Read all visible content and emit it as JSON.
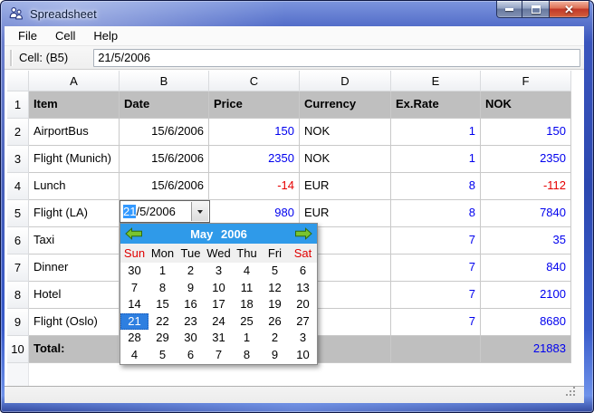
{
  "window": {
    "title": "Spreadsheet"
  },
  "titlebar_icons": {
    "close_glyph": "✕"
  },
  "menu": {
    "items": [
      "File",
      "Cell",
      "Help"
    ]
  },
  "toolbar": {
    "cell_label": "Cell: (B5)",
    "cell_value": "21/5/2006"
  },
  "spreadsheet": {
    "columns": [
      "A",
      "B",
      "C",
      "D",
      "E",
      "F"
    ],
    "rows": [
      {
        "num": "1",
        "bg": "gray",
        "cells": [
          {
            "t": "Item",
            "b": 1
          },
          {
            "t": "Date",
            "b": 1
          },
          {
            "t": "Price",
            "b": 1
          },
          {
            "t": "Currency",
            "b": 1
          },
          {
            "t": "Ex.Rate",
            "b": 1
          },
          {
            "t": "NOK",
            "b": 1
          }
        ]
      },
      {
        "num": "2",
        "cells": [
          {
            "t": "AirportBus"
          },
          {
            "t": "15/6/2006",
            "a": "r"
          },
          {
            "t": "150",
            "a": "r",
            "c": "blue"
          },
          {
            "t": "NOK"
          },
          {
            "t": "1",
            "a": "r",
            "c": "blue"
          },
          {
            "t": "150",
            "a": "r",
            "c": "blue"
          }
        ]
      },
      {
        "num": "3",
        "cells": [
          {
            "t": "Flight (Munich)"
          },
          {
            "t": "15/6/2006",
            "a": "r"
          },
          {
            "t": "2350",
            "a": "r",
            "c": "blue"
          },
          {
            "t": "NOK"
          },
          {
            "t": "1",
            "a": "r",
            "c": "blue"
          },
          {
            "t": "2350",
            "a": "r",
            "c": "blue"
          }
        ]
      },
      {
        "num": "4",
        "cells": [
          {
            "t": "Lunch"
          },
          {
            "t": "15/6/2006",
            "a": "r"
          },
          {
            "t": "-14",
            "a": "r",
            "c": "red"
          },
          {
            "t": "EUR"
          },
          {
            "t": "8",
            "a": "r",
            "c": "blue"
          },
          {
            "t": "-112",
            "a": "r",
            "c": "red"
          }
        ]
      },
      {
        "num": "5",
        "cells": [
          {
            "t": "Flight (LA)"
          },
          {
            "t": ""
          },
          {
            "t": "980",
            "a": "r",
            "c": "blue"
          },
          {
            "t": "EUR"
          },
          {
            "t": "8",
            "a": "r",
            "c": "blue"
          },
          {
            "t": "7840",
            "a": "r",
            "c": "blue"
          }
        ]
      },
      {
        "num": "6",
        "cells": [
          {
            "t": "Taxi"
          },
          {
            "t": ""
          },
          {
            "t": ""
          },
          {
            "t": ""
          },
          {
            "t": "7",
            "a": "r",
            "c": "blue"
          },
          {
            "t": "35",
            "a": "r",
            "c": "blue"
          }
        ]
      },
      {
        "num": "7",
        "cells": [
          {
            "t": "Dinner"
          },
          {
            "t": ""
          },
          {
            "t": ""
          },
          {
            "t": ""
          },
          {
            "t": "7",
            "a": "r",
            "c": "blue"
          },
          {
            "t": "840",
            "a": "r",
            "c": "blue"
          }
        ]
      },
      {
        "num": "8",
        "cells": [
          {
            "t": "Hotel"
          },
          {
            "t": ""
          },
          {
            "t": ""
          },
          {
            "t": ""
          },
          {
            "t": "7",
            "a": "r",
            "c": "blue"
          },
          {
            "t": "2100",
            "a": "r",
            "c": "blue"
          }
        ]
      },
      {
        "num": "9",
        "cells": [
          {
            "t": "Flight (Oslo)"
          },
          {
            "t": ""
          },
          {
            "t": ""
          },
          {
            "t": ""
          },
          {
            "t": "7",
            "a": "r",
            "c": "blue"
          },
          {
            "t": "8680",
            "a": "r",
            "c": "blue"
          }
        ]
      },
      {
        "num": "10",
        "bg": "gray",
        "cells": [
          {
            "t": "Total:",
            "b": 1
          },
          {
            "t": ""
          },
          {
            "t": ""
          },
          {
            "t": ""
          },
          {
            "t": ""
          },
          {
            "t": "21883",
            "a": "r",
            "c": "blue"
          }
        ]
      }
    ]
  },
  "editor": {
    "selected": "21",
    "rest": "/5/2006"
  },
  "calendar": {
    "month_year": "May 2006",
    "selected_day": "21",
    "day_names": [
      {
        "t": "Sun",
        "c": "red"
      },
      {
        "t": "Mon"
      },
      {
        "t": "Tue"
      },
      {
        "t": "Wed"
      },
      {
        "t": "Thu"
      },
      {
        "t": "Fri"
      },
      {
        "t": "Sat",
        "c": "red"
      }
    ],
    "weeks": [
      [
        {
          "d": "30",
          "s": "m"
        },
        {
          "d": "1",
          "s": "n"
        },
        {
          "d": "2",
          "s": "n"
        },
        {
          "d": "3",
          "s": "n"
        },
        {
          "d": "4",
          "s": "n"
        },
        {
          "d": "5",
          "s": "n"
        },
        {
          "d": "6",
          "s": "r"
        }
      ],
      [
        {
          "d": "7",
          "s": "r"
        },
        {
          "d": "8",
          "s": "n"
        },
        {
          "d": "9",
          "s": "n"
        },
        {
          "d": "10",
          "s": "n"
        },
        {
          "d": "11",
          "s": "n"
        },
        {
          "d": "12",
          "s": "n"
        },
        {
          "d": "13",
          "s": "r"
        }
      ],
      [
        {
          "d": "14",
          "s": "r"
        },
        {
          "d": "15",
          "s": "n"
        },
        {
          "d": "16",
          "s": "n"
        },
        {
          "d": "17",
          "s": "n"
        },
        {
          "d": "18",
          "s": "n"
        },
        {
          "d": "19",
          "s": "n"
        },
        {
          "d": "20",
          "s": "r"
        }
      ],
      [
        {
          "d": "21",
          "s": "sel"
        },
        {
          "d": "22",
          "s": "n"
        },
        {
          "d": "23",
          "s": "n"
        },
        {
          "d": "24",
          "s": "n"
        },
        {
          "d": "25",
          "s": "n"
        },
        {
          "d": "26",
          "s": "n"
        },
        {
          "d": "27",
          "s": "r"
        }
      ],
      [
        {
          "d": "28",
          "s": "r"
        },
        {
          "d": "29",
          "s": "n"
        },
        {
          "d": "30",
          "s": "n"
        },
        {
          "d": "31",
          "s": "n"
        },
        {
          "d": "1",
          "s": "m"
        },
        {
          "d": "2",
          "s": "m"
        },
        {
          "d": "3",
          "s": "m"
        }
      ],
      [
        {
          "d": "4",
          "s": "m"
        },
        {
          "d": "5",
          "s": "m"
        },
        {
          "d": "6",
          "s": "m"
        },
        {
          "d": "7",
          "s": "m"
        },
        {
          "d": "8",
          "s": "m"
        },
        {
          "d": "9",
          "s": "m"
        },
        {
          "d": "10",
          "s": "m"
        }
      ]
    ]
  },
  "colors": {
    "number_blue": "#0000ee",
    "number_red": "#e60000",
    "formatted_row_gray": "#bfbfbf",
    "calendar_header_blue": "#2f9ae9",
    "selected_day_blue": "#2e7fe0",
    "weekend_red": "#e00000",
    "muted_day_gray": "#a6a6a6",
    "nav_arrow_green": "#79c42f",
    "close_button_red": "#c13828",
    "selection_highlight": "#3399ff"
  }
}
